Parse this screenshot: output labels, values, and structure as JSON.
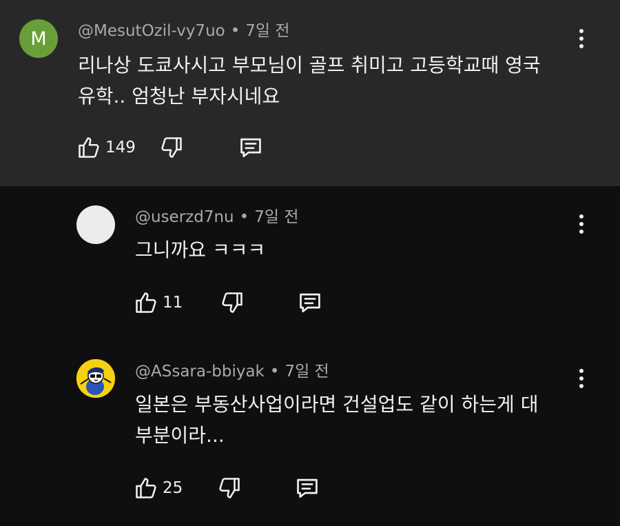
{
  "comments": [
    {
      "avatar_letter": "M",
      "avatar_color": "#689f38",
      "author": "@MesutOzil-vy7uo",
      "separator": "•",
      "time": "7일 전",
      "text_line1": "리나상 도쿄사시고 부모님이 골프 취미고 고등학교때 영국",
      "text_line2": "유학.. 엄청난 부자시네요",
      "likes": "149",
      "highlighted": true
    },
    {
      "author": "@userzd7nu",
      "separator": "•",
      "time": "7일 전",
      "text_line1": "그니까요 ㅋㅋㅋ",
      "likes": "11"
    },
    {
      "author": "@ASsara-bbiyak",
      "separator": "•",
      "time": "7일 전",
      "text_line1": "일본은 부동산사업이라면 건설업도 같이 하는게 대",
      "text_line2": "부분이라...",
      "likes": "25"
    }
  ],
  "icons": {
    "like": "thumbs-up-icon",
    "dislike": "thumbs-down-icon",
    "reply": "reply-icon",
    "menu": "more-vert-icon"
  },
  "colors": {
    "background": "#0f0f0f",
    "highlight_background": "#282828",
    "meta_text": "#aaaaaa",
    "primary_text": "#f1f1f1"
  }
}
